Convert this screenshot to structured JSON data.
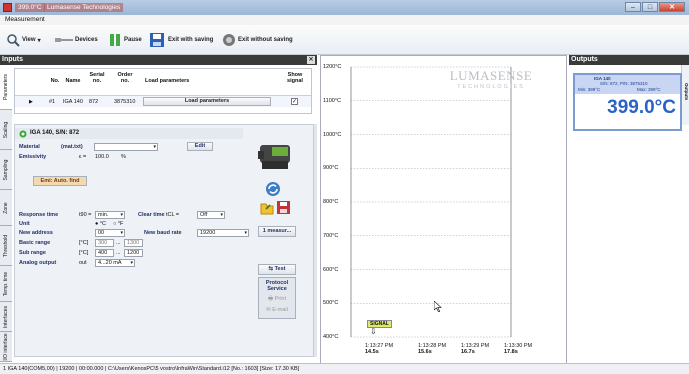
{
  "titlebar": {
    "temp": "399.0°C",
    "app": "Lumasense Technologies"
  },
  "menu": {
    "measurement": "Measurement"
  },
  "toolbar": {
    "view": "View",
    "devices": "Devices",
    "pause": "Pause",
    "exit_saving": "Exit with saving",
    "exit_without": "Exit without saving"
  },
  "inputs": {
    "title": "Inputs",
    "tabs": [
      "Parameters",
      "Scaling",
      "Sampling",
      "Zone",
      "Threshold",
      "Temp. time",
      "Interfaces",
      "I/O interface"
    ],
    "table": {
      "headers": {
        "no": "No.",
        "name": "Name",
        "serial": "Serial no.",
        "order": "Order no.",
        "load": "Load parameters",
        "show": "Show signal"
      },
      "row": {
        "no": "#1",
        "name": "IGA 140",
        "serial": "872",
        "order": "3875310",
        "load_button": "Load parameters",
        "show_checked": true
      }
    },
    "device": {
      "title": "IGA 140, S/N: 872",
      "material_label": "Material",
      "material_unit": "(mat.txt)",
      "material_value": "",
      "edit_button": "Edit",
      "emissivity_label": "Emissivity",
      "emissivity_symbol": "ε =",
      "emissivity_value": "100.0",
      "emissivity_unit": "%",
      "emi_auto_button": "Emi: Auto. find",
      "response_label": "Response time",
      "response_sym": "t90 =",
      "response_value": "min.",
      "clear_label": "Clear time",
      "clear_sym": "tCL =",
      "clear_value": "Off",
      "unit_label": "Unit",
      "unit_c": "°C",
      "unit_f": "°F",
      "new_address_label": "New address",
      "new_address_value": "00",
      "baud_label": "New baud rate",
      "baud_value": "19200",
      "basic_range_label": "Basic range",
      "basic_range_unit": "[°C]",
      "basic_min": "300",
      "basic_max": "1300",
      "sub_range_label": "Sub range",
      "sub_range_unit": "[°C]",
      "sub_min": "400",
      "sub_max": "1200",
      "analog_label": "Analog output",
      "analog_sym": "out",
      "analog_value": "4...20 mA",
      "measure_button": "1 measur...",
      "test_button": "Test",
      "protocol_button": "Protocol Service",
      "print_button": "Print",
      "email_button": "E-mail"
    }
  },
  "graph": {
    "y_ticks": [
      "1200°C",
      "1100°C",
      "1000°C",
      "900°C",
      "800°C",
      "700°C",
      "600°C",
      "500°C",
      "400°C"
    ],
    "x_ticks": [
      {
        "time": "1:13:27 PM",
        "sec": "14.5s"
      },
      {
        "time": "1:13:28 PM",
        "sec": "15.6s"
      },
      {
        "time": "1:13:29 PM",
        "sec": "16.7s"
      },
      {
        "time": "1:13:30 PM",
        "sec": "17.8s"
      }
    ],
    "logo_main": "LUMASENSE",
    "logo_sub": "TECHNOLOGIES",
    "signal_label": "SIGNAL"
  },
  "outputs": {
    "title": "Outputs",
    "side_tab": "Outputs",
    "card": {
      "device": "IGA 140",
      "sn": "S/N: 872,  P/N: 3875310",
      "min": "Min: 399°C",
      "max": "Max: 399°C",
      "value": "399.0°C"
    }
  },
  "status": {
    "text": "1  IGA 140(COM5,00)  |  19200  |  00:00.000  |  C:\\Users\\KenosPC\\5 vostro\\InfraWin\\Standard.i12  [No.: 1603]  [Size: 17.30 KB]"
  },
  "colors": {
    "accent": "#3a3a3a",
    "selected_blue": "#c8d6f4",
    "output_border": "#7b9bd3",
    "signal": "#dfe96a"
  }
}
